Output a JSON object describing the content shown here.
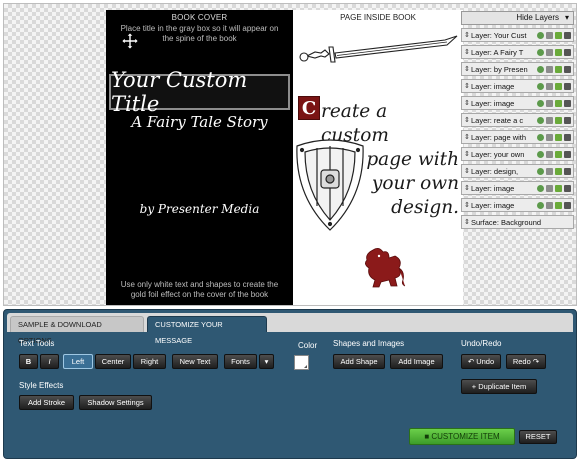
{
  "cover": {
    "header": "BOOK COVER",
    "hint_top": "Place title in the gray box so it will appear on the spine of the book",
    "title": "Your Custom Title",
    "subtitle": "A Fairy Tale Story",
    "author": "by Presenter Media",
    "hint_bottom": "Use only white text and shapes to create the gold foil effect on the cover of the book"
  },
  "inside": {
    "header": "PAGE INSIDE BOOK",
    "drop_cap": "C",
    "line1": "reate a custom",
    "line2": "page with",
    "line3": "your own",
    "line4": "design."
  },
  "layers": {
    "hide_label": "Hide Layers",
    "items": [
      {
        "name": "Layer: Your Cust"
      },
      {
        "name": "Layer: A Fairy T"
      },
      {
        "name": "Layer: by Presen"
      },
      {
        "name": "Layer: image"
      },
      {
        "name": "Layer: image"
      },
      {
        "name": "Layer: reate a c"
      },
      {
        "name": "Layer: page with"
      },
      {
        "name": "Layer: your own"
      },
      {
        "name": "Layer: design,"
      },
      {
        "name": "Layer: image"
      },
      {
        "name": "Layer: image"
      }
    ],
    "surface": "Surface: Background"
  },
  "tabs": {
    "sample": "SAMPLE & DOWNLOAD OPTIONS",
    "customize": "CUSTOMIZE YOUR MESSAGE"
  },
  "text_tools": {
    "label": "Text Tools",
    "bold": "B",
    "italic": "I",
    "left": "Left",
    "center": "Center",
    "right": "Right",
    "new_text": "New Text",
    "fonts": "Fonts",
    "fonts_arrow": "▾"
  },
  "color": {
    "label": "Color",
    "value": "#ffffff"
  },
  "shapes": {
    "label": "Shapes and Images",
    "add_shape": "Add Shape",
    "add_image": "Add Image"
  },
  "undo_redo": {
    "label": "Undo/Redo",
    "undo": "↶ Undo",
    "redo": "Redo ↷",
    "duplicate": "+ Duplicate Item"
  },
  "style_effects": {
    "label": "Style Effects",
    "add_stroke": "Add Stroke",
    "shadow_settings": "Shadow Settings"
  },
  "actions": {
    "customize_item": "CUSTOMIZE ITEM",
    "reset": "RESET"
  },
  "colors": {
    "panel": "#2f5873",
    "accent_green": "#5bbf3c",
    "drop_cap": "#7a1414"
  }
}
